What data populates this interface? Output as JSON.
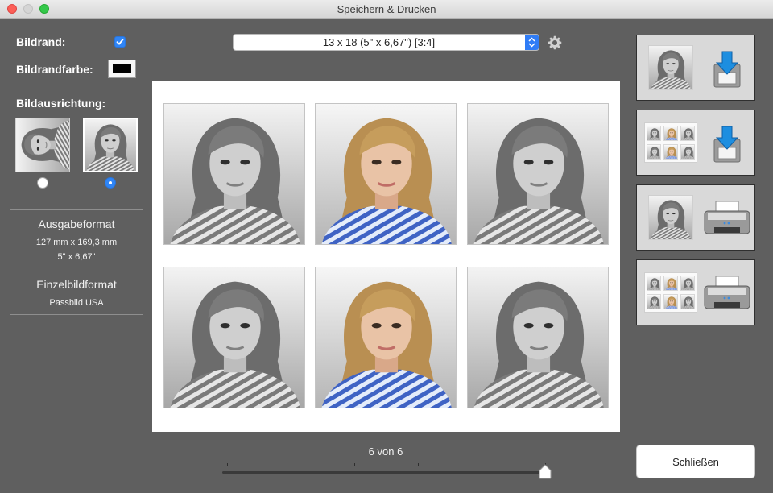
{
  "window": {
    "title": "Speichern & Drucken"
  },
  "settings": {
    "border_label": "Bildrand:",
    "border_checked": true,
    "border_color_label": "Bildrandfarbe:",
    "border_color": "#000000",
    "orientation_label": "Bildausrichtung:",
    "orientation_selected": "portrait"
  },
  "output": {
    "title": "Ausgabeformat",
    "size_mm": "127 mm x 169,3 mm",
    "size_inch": "5\" x 6,67\""
  },
  "single": {
    "title": "Einzelbildformat",
    "value": "Passbild USA"
  },
  "format": {
    "selected": "13 x 18 (5\" x 6,67\") [3:4]"
  },
  "preview": {
    "photos": [
      "grayscale",
      "color",
      "grayscale",
      "grayscale",
      "color",
      "grayscale"
    ]
  },
  "pager": {
    "label": "6 von 6",
    "current": 6,
    "total": 6
  },
  "buttons": {
    "close": "Schließen"
  },
  "colors": {
    "accent": "#2f85f6",
    "background": "#5f5f5f",
    "paper": "#ffffff"
  },
  "icons": {
    "save_single": [
      "portrait-thumbnail-icon",
      "save-download-icon"
    ],
    "save_sheet": [
      "sheet-thumbnail-icon",
      "save-download-icon"
    ],
    "print_single": [
      "portrait-thumbnail-icon",
      "printer-icon"
    ],
    "print_sheet": [
      "sheet-thumbnail-icon",
      "printer-icon"
    ]
  }
}
